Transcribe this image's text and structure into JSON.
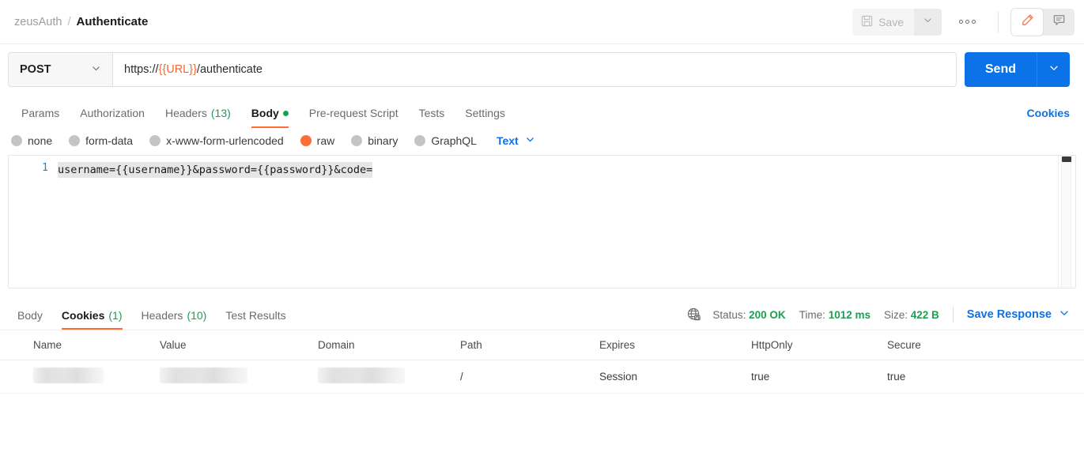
{
  "header": {
    "collection": "zeusAuth",
    "separator": "/",
    "request_name": "Authenticate",
    "save_label": "Save",
    "save_icon": "floppy-disk-icon",
    "save_caret_icon": "chevron-down-icon",
    "more_icon": "ellipsis-icon",
    "edit_icon": "pencil-icon",
    "comment_icon": "comment-icon",
    "accent_orange": "#ff6c37"
  },
  "request": {
    "method": "POST",
    "method_caret_icon": "chevron-down-icon",
    "url_prefix": "https://",
    "url_variable": "{{URL}}",
    "url_suffix": "/authenticate",
    "send_label": "Send",
    "send_caret_icon": "chevron-down-icon",
    "send_color": "#0c72e8"
  },
  "request_tabs": {
    "items": [
      {
        "label": "Params",
        "count": "",
        "active": false,
        "dot": false
      },
      {
        "label": "Authorization",
        "count": "",
        "active": false,
        "dot": false
      },
      {
        "label": "Headers",
        "count": "(13)",
        "active": false,
        "dot": false
      },
      {
        "label": "Body",
        "count": "",
        "active": true,
        "dot": true
      },
      {
        "label": "Pre-request Script",
        "count": "",
        "active": false,
        "dot": false
      },
      {
        "label": "Tests",
        "count": "",
        "active": false,
        "dot": false
      },
      {
        "label": "Settings",
        "count": "",
        "active": false,
        "dot": false
      }
    ],
    "cookies_link": "Cookies"
  },
  "body_types": {
    "options": [
      {
        "label": "none",
        "selected": false
      },
      {
        "label": "form-data",
        "selected": false
      },
      {
        "label": "x-www-form-urlencoded",
        "selected": false
      },
      {
        "label": "raw",
        "selected": true
      },
      {
        "label": "binary",
        "selected": false
      },
      {
        "label": "GraphQL",
        "selected": false
      }
    ],
    "format_label": "Text",
    "format_caret_icon": "chevron-down-icon"
  },
  "editor": {
    "line_number": "1",
    "content": "username={{username}}&password={{password}}&code=",
    "scrollbar": "vertical-scrollbar"
  },
  "response_tabs": {
    "items": [
      {
        "label": "Body",
        "count": "",
        "active": false
      },
      {
        "label": "Cookies",
        "count": "(1)",
        "active": true
      },
      {
        "label": "Headers",
        "count": "(10)",
        "active": false
      },
      {
        "label": "Test Results",
        "count": "",
        "active": false
      }
    ]
  },
  "response_meta": {
    "security_icon": "globe-lock-icon",
    "status_label": "Status:",
    "status_value": "200 OK",
    "time_label": "Time:",
    "time_value": "1012 ms",
    "size_label": "Size:",
    "size_value": "422 B",
    "save_response_label": "Save Response",
    "save_response_caret_icon": "chevron-down-icon",
    "success_color": "#1e9e53"
  },
  "cookies_table": {
    "columns": [
      "Name",
      "Value",
      "Domain",
      "Path",
      "Expires",
      "HttpOnly",
      "Secure"
    ],
    "rows": [
      {
        "name": "",
        "value": "",
        "domain": "",
        "path": "/",
        "expires": "Session",
        "httponly": "true",
        "secure": "true",
        "name_redacted": true,
        "value_redacted": true,
        "domain_redacted": true
      }
    ]
  }
}
